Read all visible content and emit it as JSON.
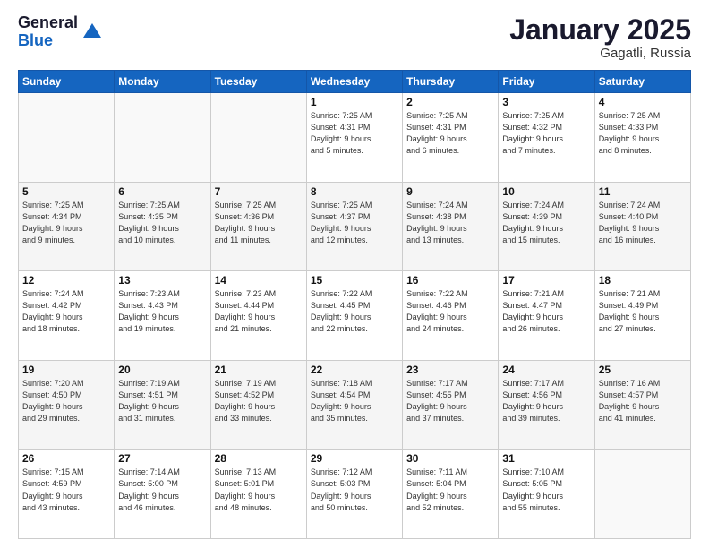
{
  "logo": {
    "general": "General",
    "blue": "Blue"
  },
  "header": {
    "title": "January 2025",
    "subtitle": "Gagatli, Russia"
  },
  "weekdays": [
    "Sunday",
    "Monday",
    "Tuesday",
    "Wednesday",
    "Thursday",
    "Friday",
    "Saturday"
  ],
  "weeks": [
    [
      {
        "day": "",
        "info": ""
      },
      {
        "day": "",
        "info": ""
      },
      {
        "day": "",
        "info": ""
      },
      {
        "day": "1",
        "info": "Sunrise: 7:25 AM\nSunset: 4:31 PM\nDaylight: 9 hours\nand 5 minutes."
      },
      {
        "day": "2",
        "info": "Sunrise: 7:25 AM\nSunset: 4:31 PM\nDaylight: 9 hours\nand 6 minutes."
      },
      {
        "day": "3",
        "info": "Sunrise: 7:25 AM\nSunset: 4:32 PM\nDaylight: 9 hours\nand 7 minutes."
      },
      {
        "day": "4",
        "info": "Sunrise: 7:25 AM\nSunset: 4:33 PM\nDaylight: 9 hours\nand 8 minutes."
      }
    ],
    [
      {
        "day": "5",
        "info": "Sunrise: 7:25 AM\nSunset: 4:34 PM\nDaylight: 9 hours\nand 9 minutes."
      },
      {
        "day": "6",
        "info": "Sunrise: 7:25 AM\nSunset: 4:35 PM\nDaylight: 9 hours\nand 10 minutes."
      },
      {
        "day": "7",
        "info": "Sunrise: 7:25 AM\nSunset: 4:36 PM\nDaylight: 9 hours\nand 11 minutes."
      },
      {
        "day": "8",
        "info": "Sunrise: 7:25 AM\nSunset: 4:37 PM\nDaylight: 9 hours\nand 12 minutes."
      },
      {
        "day": "9",
        "info": "Sunrise: 7:24 AM\nSunset: 4:38 PM\nDaylight: 9 hours\nand 13 minutes."
      },
      {
        "day": "10",
        "info": "Sunrise: 7:24 AM\nSunset: 4:39 PM\nDaylight: 9 hours\nand 15 minutes."
      },
      {
        "day": "11",
        "info": "Sunrise: 7:24 AM\nSunset: 4:40 PM\nDaylight: 9 hours\nand 16 minutes."
      }
    ],
    [
      {
        "day": "12",
        "info": "Sunrise: 7:24 AM\nSunset: 4:42 PM\nDaylight: 9 hours\nand 18 minutes."
      },
      {
        "day": "13",
        "info": "Sunrise: 7:23 AM\nSunset: 4:43 PM\nDaylight: 9 hours\nand 19 minutes."
      },
      {
        "day": "14",
        "info": "Sunrise: 7:23 AM\nSunset: 4:44 PM\nDaylight: 9 hours\nand 21 minutes."
      },
      {
        "day": "15",
        "info": "Sunrise: 7:22 AM\nSunset: 4:45 PM\nDaylight: 9 hours\nand 22 minutes."
      },
      {
        "day": "16",
        "info": "Sunrise: 7:22 AM\nSunset: 4:46 PM\nDaylight: 9 hours\nand 24 minutes."
      },
      {
        "day": "17",
        "info": "Sunrise: 7:21 AM\nSunset: 4:47 PM\nDaylight: 9 hours\nand 26 minutes."
      },
      {
        "day": "18",
        "info": "Sunrise: 7:21 AM\nSunset: 4:49 PM\nDaylight: 9 hours\nand 27 minutes."
      }
    ],
    [
      {
        "day": "19",
        "info": "Sunrise: 7:20 AM\nSunset: 4:50 PM\nDaylight: 9 hours\nand 29 minutes."
      },
      {
        "day": "20",
        "info": "Sunrise: 7:19 AM\nSunset: 4:51 PM\nDaylight: 9 hours\nand 31 minutes."
      },
      {
        "day": "21",
        "info": "Sunrise: 7:19 AM\nSunset: 4:52 PM\nDaylight: 9 hours\nand 33 minutes."
      },
      {
        "day": "22",
        "info": "Sunrise: 7:18 AM\nSunset: 4:54 PM\nDaylight: 9 hours\nand 35 minutes."
      },
      {
        "day": "23",
        "info": "Sunrise: 7:17 AM\nSunset: 4:55 PM\nDaylight: 9 hours\nand 37 minutes."
      },
      {
        "day": "24",
        "info": "Sunrise: 7:17 AM\nSunset: 4:56 PM\nDaylight: 9 hours\nand 39 minutes."
      },
      {
        "day": "25",
        "info": "Sunrise: 7:16 AM\nSunset: 4:57 PM\nDaylight: 9 hours\nand 41 minutes."
      }
    ],
    [
      {
        "day": "26",
        "info": "Sunrise: 7:15 AM\nSunset: 4:59 PM\nDaylight: 9 hours\nand 43 minutes."
      },
      {
        "day": "27",
        "info": "Sunrise: 7:14 AM\nSunset: 5:00 PM\nDaylight: 9 hours\nand 46 minutes."
      },
      {
        "day": "28",
        "info": "Sunrise: 7:13 AM\nSunset: 5:01 PM\nDaylight: 9 hours\nand 48 minutes."
      },
      {
        "day": "29",
        "info": "Sunrise: 7:12 AM\nSunset: 5:03 PM\nDaylight: 9 hours\nand 50 minutes."
      },
      {
        "day": "30",
        "info": "Sunrise: 7:11 AM\nSunset: 5:04 PM\nDaylight: 9 hours\nand 52 minutes."
      },
      {
        "day": "31",
        "info": "Sunrise: 7:10 AM\nSunset: 5:05 PM\nDaylight: 9 hours\nand 55 minutes."
      },
      {
        "day": "",
        "info": ""
      }
    ]
  ]
}
